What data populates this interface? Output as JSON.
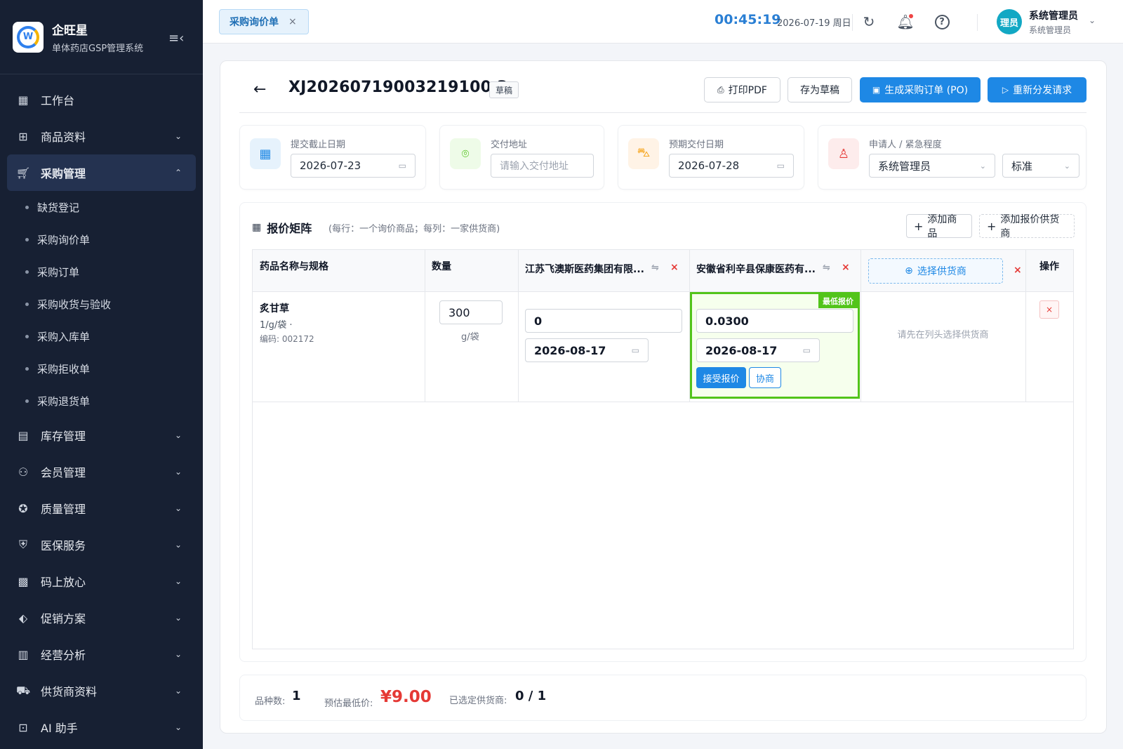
{
  "sidebar": {
    "brand": "企旺星",
    "subtitle": "单体药店GSP管理系统",
    "logo_letter": "W",
    "items": [
      {
        "label": "工作台",
        "icon": "dashboard-icon"
      },
      {
        "label": "商品资料",
        "icon": "product-icon"
      },
      {
        "label": "采购管理",
        "icon": "cart-icon",
        "active": true
      },
      {
        "label": "库存管理",
        "icon": "inventory-icon"
      },
      {
        "label": "会员管理",
        "icon": "members-icon"
      },
      {
        "label": "质量管理",
        "icon": "quality-icon"
      },
      {
        "label": "医保服务",
        "icon": "shield-icon"
      },
      {
        "label": "码上放心",
        "icon": "qrcode-icon"
      },
      {
        "label": "促销方案",
        "icon": "tag-icon"
      },
      {
        "label": "经营分析",
        "icon": "chart-icon"
      },
      {
        "label": "供货商资料",
        "icon": "truck-icon"
      },
      {
        "label": "AI 助手",
        "icon": "robot-icon"
      }
    ],
    "purchase_sub": [
      "缺货登记",
      "采购询价单",
      "采购订单",
      "采购收货与验收",
      "采购入库单",
      "采购拒收单",
      "采购退货单"
    ]
  },
  "topbar": {
    "tab_label": "采购询价单",
    "clock": "00:45:19",
    "date": "2026-07-19 周日",
    "avatar_text": "理员",
    "user_name": "系统管理员",
    "user_role": "系统管理员"
  },
  "header": {
    "doc_no": "XJ20260719003219100 3",
    "status": "草稿",
    "print_label": "打印PDF",
    "save_draft_label": "存为草稿",
    "generate_po_label": "生成采购订单 (PO)",
    "resend_label": "重新分发请求"
  },
  "info": {
    "deadline_label": "提交截止日期",
    "deadline_value": "2026-07-23",
    "address_label": "交付地址",
    "address_placeholder": "请输入交付地址",
    "expected_label": "预期交付日期",
    "expected_value": "2026-07-28",
    "requester_label": "申请人 / 紧急程度",
    "requester_value": "系统管理员",
    "urgency_value": "标准"
  },
  "matrix": {
    "title": "报价矩阵",
    "note": "(每行：一个询价商品；每列：一家供货商)",
    "add_product_label": "添加商品",
    "add_supplier_label": "添加报价供货商",
    "col_product": "药品名称与规格",
    "col_qty": "数量",
    "supplier1": "江苏飞澳斯医药集团有限...",
    "supplier2": "安徽省利辛县保康医药有...",
    "pick_supplier_label": "选择供货商",
    "col_action": "操作",
    "best_tag": "最低报价",
    "row": {
      "name": "炙甘草",
      "spec": "1/g/袋 ·",
      "code": "编码: 002172",
      "qty": "300",
      "unit": "g/袋",
      "s1_price": "0",
      "s1_date": "2026-08-17",
      "s2_price": "0.0300",
      "s2_date": "2026-08-17",
      "accept_label": "接受报价",
      "negotiate_label": "协商",
      "empty_hint": "请先在列头选择供货商",
      "delete_label": "×"
    }
  },
  "footer": {
    "variety_label": "品种数:",
    "variety_value": "1",
    "lowest_label": "预估最低价:",
    "lowest_value": "¥9.00",
    "selected_label": "已选定供货商:",
    "selected_value": "0 / 1"
  },
  "colors": {
    "primary": "#1e88e5",
    "best": "#52c41a",
    "danger": "#e53935",
    "sidebar_bg": "#172033"
  }
}
